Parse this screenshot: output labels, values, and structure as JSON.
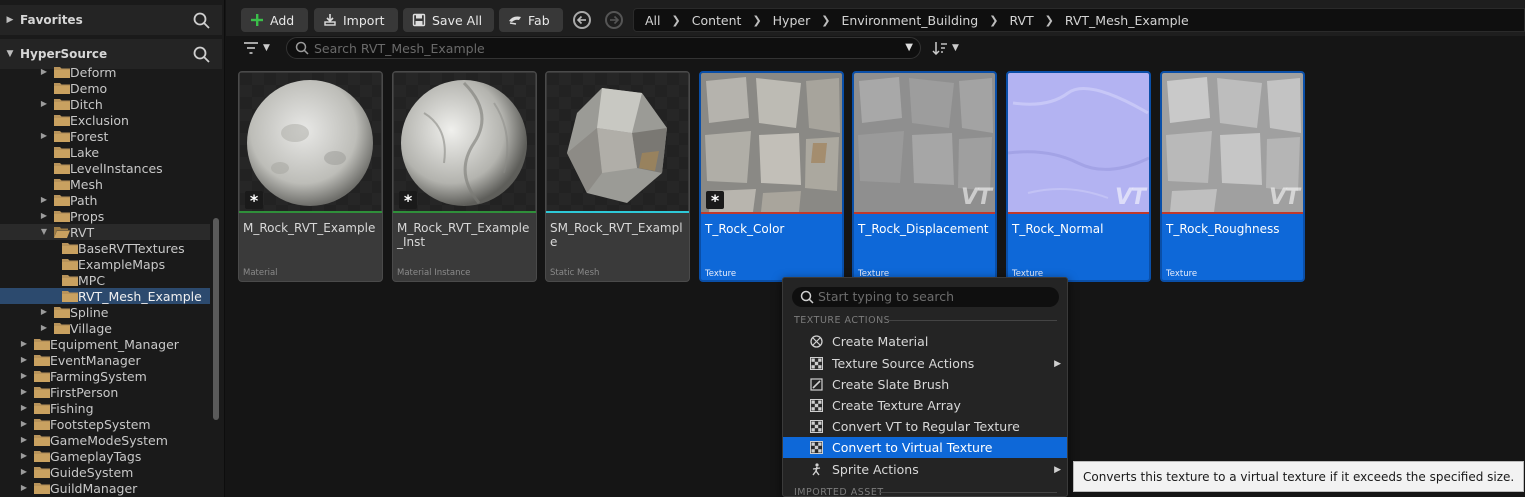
{
  "left_panel": {
    "favorites_title": "Favorites",
    "source_title": "HyperSource",
    "tree": [
      {
        "label": "Deform",
        "depth": 1,
        "expandable": true
      },
      {
        "label": "Demo",
        "depth": 1,
        "expandable": false
      },
      {
        "label": "Ditch",
        "depth": 1,
        "expandable": true
      },
      {
        "label": "Exclusion",
        "depth": 1,
        "expandable": false
      },
      {
        "label": "Forest",
        "depth": 1,
        "expandable": true
      },
      {
        "label": "Lake",
        "depth": 1,
        "expandable": false
      },
      {
        "label": "LevelInstances",
        "depth": 1,
        "expandable": false
      },
      {
        "label": "Mesh",
        "depth": 1,
        "expandable": false
      },
      {
        "label": "Path",
        "depth": 1,
        "expandable": true
      },
      {
        "label": "Props",
        "depth": 1,
        "expandable": true
      },
      {
        "label": "RVT",
        "depth": 1,
        "expandable": true,
        "expanded": true
      },
      {
        "label": "BaseRVTTextures",
        "depth": 2,
        "expandable": false
      },
      {
        "label": "ExampleMaps",
        "depth": 2,
        "expandable": false
      },
      {
        "label": "MPC",
        "depth": 2,
        "expandable": false
      },
      {
        "label": "RVT_Mesh_Example",
        "depth": 2,
        "expandable": false,
        "selected": true
      },
      {
        "label": "Spline",
        "depth": 1,
        "expandable": true
      },
      {
        "label": "Village",
        "depth": 1,
        "expandable": true
      },
      {
        "label": "Equipment_Manager",
        "depth": 0,
        "expandable": true
      },
      {
        "label": "EventManager",
        "depth": 0,
        "expandable": true
      },
      {
        "label": "FarmingSystem",
        "depth": 0,
        "expandable": true
      },
      {
        "label": "FirstPerson",
        "depth": 0,
        "expandable": true
      },
      {
        "label": "Fishing",
        "depth": 0,
        "expandable": true
      },
      {
        "label": "FootstepSystem",
        "depth": 0,
        "expandable": true
      },
      {
        "label": "GameModeSystem",
        "depth": 0,
        "expandable": true
      },
      {
        "label": "GameplayTags",
        "depth": 0,
        "expandable": true
      },
      {
        "label": "GuideSystem",
        "depth": 0,
        "expandable": true
      },
      {
        "label": "GuildManager",
        "depth": 0,
        "expandable": true
      }
    ]
  },
  "toolbar": {
    "add_label": "Add",
    "import_label": "Import",
    "save_all_label": "Save All",
    "fab_label": "Fab"
  },
  "breadcrumbs": [
    "All",
    "Content",
    "Hyper",
    "Environment_Building",
    "RVT",
    "RVT_Mesh_Example"
  ],
  "search": {
    "placeholder": "Search RVT_Mesh_Example"
  },
  "assets": [
    {
      "name": "M_Rock_RVT_Example",
      "type": "Material",
      "selected": false,
      "strip_color": "#2f8f3a",
      "thumb": "sphere-smooth",
      "dirty": true,
      "vt": false
    },
    {
      "name": "M_Rock_RVT_Example_Inst",
      "type": "Material Instance",
      "selected": false,
      "strip_color": "#2f8f3a",
      "thumb": "sphere-rough",
      "dirty": true,
      "vt": false
    },
    {
      "name": "SM_Rock_RVT_Example",
      "type": "Static Mesh",
      "selected": false,
      "strip_color": "#2ec9d8",
      "thumb": "rock",
      "dirty": false,
      "vt": false
    },
    {
      "name": "T_Rock_Color",
      "type": "Texture",
      "selected": true,
      "strip_color": "#c0392b",
      "thumb": "tex-color",
      "dirty": true,
      "vt": false
    },
    {
      "name": "T_Rock_Displacement",
      "type": "Texture",
      "selected": true,
      "strip_color": "#c0392b",
      "thumb": "tex-disp",
      "dirty": false,
      "vt": true
    },
    {
      "name": "T_Rock_Normal",
      "type": "Texture",
      "selected": true,
      "strip_color": "#c0392b",
      "thumb": "tex-normal",
      "dirty": false,
      "vt": true
    },
    {
      "name": "T_Rock_Roughness",
      "type": "Texture",
      "selected": true,
      "strip_color": "#c0392b",
      "thumb": "tex-rough",
      "dirty": false,
      "vt": true
    }
  ],
  "vt_badge": "VT",
  "context_menu": {
    "search_placeholder": "Start typing to search",
    "section_texture": "TEXTURE ACTIONS",
    "items": [
      {
        "label": "Create Material",
        "icon": "material-icon",
        "submenu": false,
        "highlighted": false
      },
      {
        "label": "Texture Source Actions",
        "icon": "checker-icon",
        "submenu": true,
        "highlighted": false
      },
      {
        "label": "Create Slate Brush",
        "icon": "brush-icon",
        "submenu": false,
        "highlighted": false
      },
      {
        "label": "Create Texture Array",
        "icon": "checker-icon",
        "submenu": false,
        "highlighted": false
      },
      {
        "label": "Convert VT to Regular Texture",
        "icon": "checker-icon",
        "submenu": false,
        "highlighted": false
      },
      {
        "label": "Convert to Virtual Texture",
        "icon": "checker-icon",
        "submenu": false,
        "highlighted": true
      },
      {
        "label": "Sprite Actions",
        "icon": "sprite-icon",
        "submenu": true,
        "highlighted": false
      }
    ],
    "section_imported": "IMPORTED ASSET"
  },
  "tooltip": "Converts this texture to a virtual texture if it exceeds the specified size."
}
